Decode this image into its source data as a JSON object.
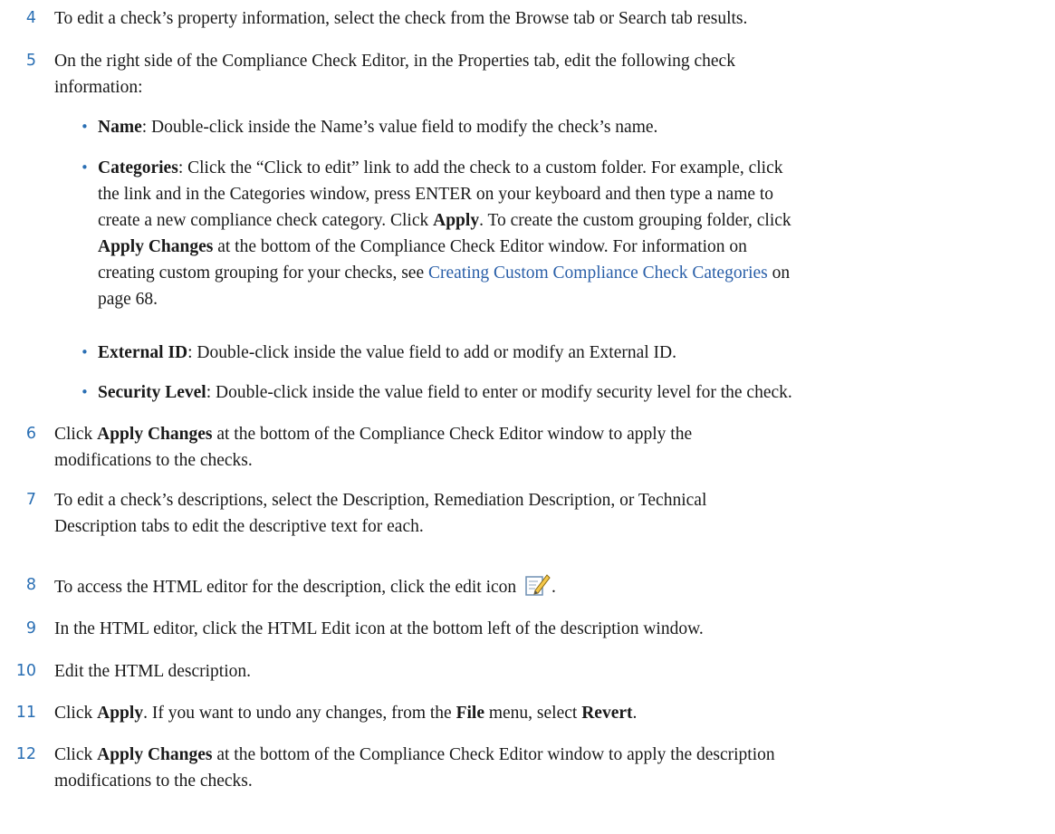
{
  "steps": [
    {
      "num": "4",
      "text": "To edit a check’s property information, select the check from the Browse tab or Search tab results."
    },
    {
      "num": "5",
      "line1": "On the right side of the Compliance Check Editor, in the Properties tab, edit the following check",
      "line2": "information:"
    },
    {
      "num": "6",
      "a": "Click ",
      "b": "Apply Changes",
      "c": " at the bottom of the Compliance Check Editor window to apply the",
      "line2": "modifications to the checks."
    },
    {
      "num": "7",
      "line1": "To edit a check’s descriptions, select the Description, Remediation Description, or Technical",
      "line2": "Description tabs to edit the descriptive text for each."
    },
    {
      "num": "8",
      "text": "To access the HTML editor for the description, click the edit icon",
      "after": "."
    },
    {
      "num": "9",
      "text": "In the HTML editor, click the HTML Edit icon at the bottom left of the description window."
    },
    {
      "num": "10",
      "text": "Edit the HTML description."
    },
    {
      "num": "11",
      "a": "Click ",
      "b": "Apply",
      "c": ". If you want to undo any changes, from the ",
      "d": "File",
      "e": " menu, select ",
      "f": "Revert",
      "g": "."
    },
    {
      "num": "12",
      "a": "Click ",
      "b": "Apply Changes",
      "c": " at the bottom of the Compliance Check Editor window to apply the description",
      "line2": "modifications to the checks."
    }
  ],
  "bullets": [
    {
      "mark": "•",
      "term": "Name",
      "rest": ": Double-click inside the Name’s value field to modify the check’s name."
    },
    {
      "mark": "•",
      "term": "Categories",
      "l1": ": Click the “Click to edit” link to add the check to a custom folder. For example, click",
      "l2": "the link and in the Categories window, press ENTER on your keyboard and then type a name to",
      "l3a": "create a new compliance check category. Click ",
      "l3b": "Apply",
      "l3c": ". To create the custom grouping folder, click",
      "l4a": "Apply Changes",
      "l4b": " at the bottom of the Compliance Check Editor window. For information on",
      "l5a": "creating custom grouping for your checks, see ",
      "l5link": "Creating Custom Compliance Check Categories",
      "l5b": " on",
      "l6": "page 68."
    },
    {
      "mark": "•",
      "term": "External ID",
      "rest": ": Double-click inside the value field to add or modify an External ID."
    },
    {
      "mark": "•",
      "term": "Security Level",
      "rest": ": Double-click inside the value field to enter or modify security level for the check."
    }
  ],
  "icons": {
    "edit": "edit-note-icon"
  }
}
